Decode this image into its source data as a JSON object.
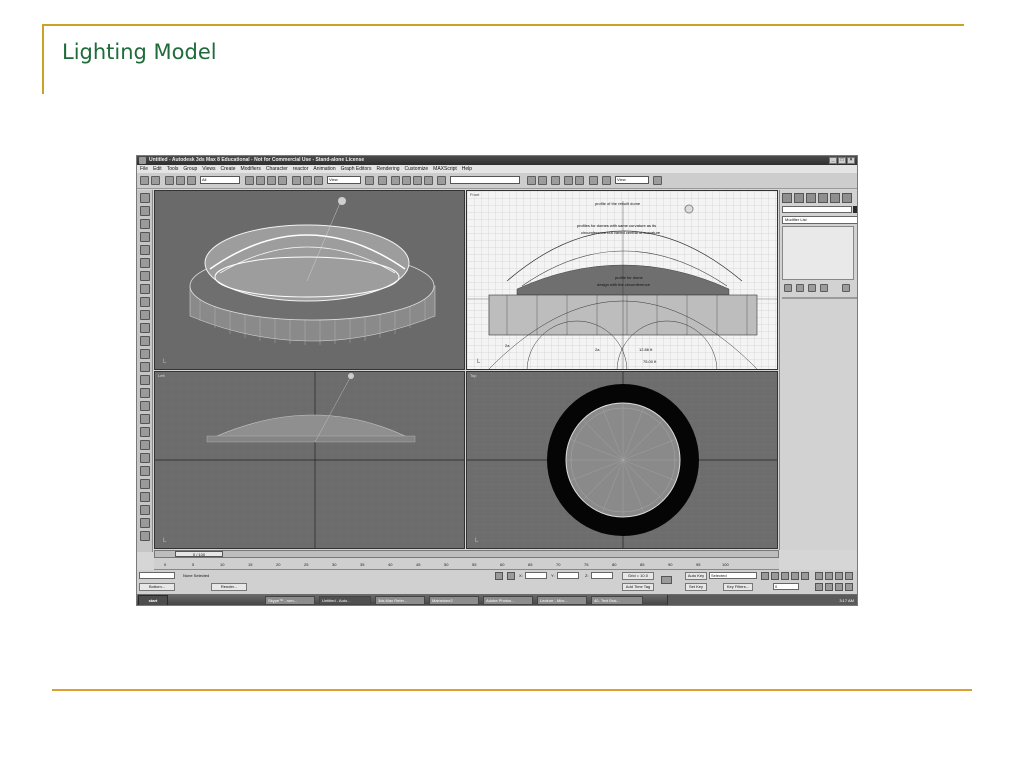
{
  "slide": {
    "title": "Lighting Model"
  },
  "window": {
    "title": "Untitled - Autodesk 3ds Max 8 Educational - Not for Commercial Use - Stand-alone License",
    "minimize": "_",
    "maximize": "□",
    "close": "×"
  },
  "menu": [
    "File",
    "Edit",
    "Tools",
    "Group",
    "Views",
    "Create",
    "Modifiers",
    "Character",
    "reactor",
    "Animation",
    "Graph Editors",
    "Rendering",
    "Customize",
    "MAXScript",
    "Help"
  ],
  "toolbar": {
    "selection_filter": "All",
    "ref_coord": "View",
    "named_selection": "",
    "render_view": "View"
  },
  "viewports": {
    "perspective": "Perspective",
    "front": "Front",
    "left": "Left",
    "top": "Top",
    "front_annotations": [
      "profile of the rebuilt dome",
      "profiles for domes with same curvature as its",
      "circumference but varied central of curvature",
      "profile for dome",
      "design with the circumference",
      "2a",
      "2a",
      "12.86 ft",
      "75.00 ft"
    ]
  },
  "command_panel": {
    "modifier_list": "Modifier List"
  },
  "timeline": {
    "frame": "0 / 100",
    "ticks": [
      "0",
      "5",
      "10",
      "15",
      "20",
      "25",
      "30",
      "35",
      "40",
      "45",
      "50",
      "55",
      "60",
      "65",
      "70",
      "75",
      "80",
      "85",
      "90",
      "95",
      "100"
    ]
  },
  "status": {
    "selection": "None Selected",
    "maxscript": "Bottom...",
    "render_label": "Render...",
    "x_label": "X:",
    "y_label": "Y:",
    "z_label": "Z:",
    "x_value": "",
    "y_value": "",
    "z_value": "",
    "grid": "Grid = 10.0",
    "add_time_tag": "Add Time Tag",
    "auto_key": "Auto Key",
    "set_key": "Set Key",
    "key_mode": "Selected",
    "key_filters": "Key Filters...",
    "current_frame": "0"
  },
  "taskbar": {
    "start": "start",
    "items": [
      "Skype™ - rom...",
      "Untitled - Auto...",
      "3ds Max Refer...",
      "Mainstone2",
      "Adobe Photos...",
      "Lecture - Micr...",
      "40- Text Brai..."
    ],
    "active_index": 1,
    "clock": "3:17 AM"
  },
  "colors": {
    "accent_line": "#c9a227",
    "bottom_line": "#e0a030",
    "title_green": "#1f6b3a"
  }
}
